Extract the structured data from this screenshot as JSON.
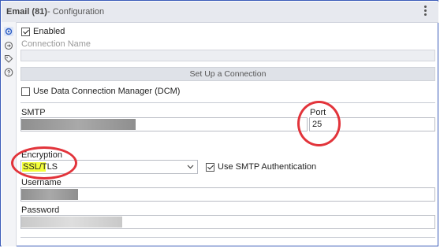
{
  "header": {
    "title": "Email (81)",
    "subtitle": "- Configuration"
  },
  "rail": {
    "icons": [
      "settings-icon",
      "output-icon",
      "tag-icon",
      "help-icon"
    ]
  },
  "form": {
    "enabled_label": "Enabled",
    "enabled_checked": true,
    "connection_name_label": "Connection Name",
    "connection_name_value": "",
    "setup_button": "Set Up a Connection",
    "dcm_label": "Use Data Connection Manager (DCM)",
    "dcm_checked": false,
    "smtp_label": "SMTP",
    "port_label": "Port",
    "port_value": "25",
    "encryption_label": "Encryption",
    "encryption_value": "SSL/TLS",
    "smtp_auth_label": "Use SMTP Authentication",
    "smtp_auth_checked": true,
    "username_label": "Username",
    "password_label": "Password"
  },
  "colors": {
    "annotation_ring": "#e2343b",
    "highlight": "#f4ff3c",
    "frame_border": "#3b5bb8"
  }
}
